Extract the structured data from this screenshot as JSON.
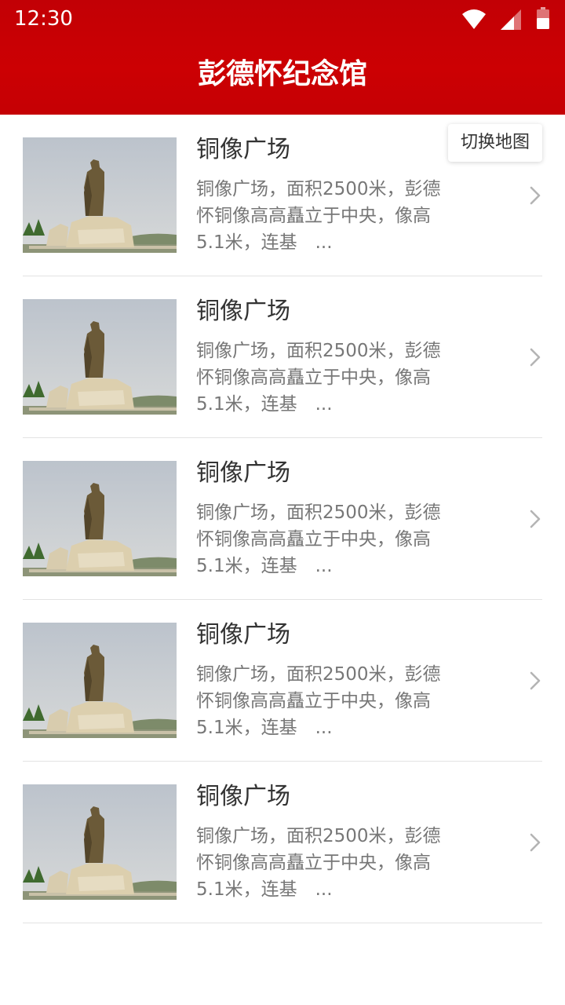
{
  "status_bar": {
    "time": "12:30",
    "icons": [
      "wifi-icon",
      "signal-icon",
      "battery-icon"
    ]
  },
  "header": {
    "title": "彭德怀纪念馆",
    "background_color": "#c8000a"
  },
  "map_toggle": {
    "label": "切换地图"
  },
  "list": {
    "items": [
      {
        "title": "铜像广场",
        "desc_lines": [
          "铜像广场，面积2500米，彭德",
          "怀铜像高高矗立于中央，像高",
          "5.1米，连基　..."
        ],
        "image": "statue-photo"
      },
      {
        "title": "铜像广场",
        "desc_lines": [
          "铜像广场，面积2500米，彭德",
          "怀铜像高高矗立于中央，像高",
          "5.1米，连基　..."
        ],
        "image": "statue-photo"
      },
      {
        "title": "铜像广场",
        "desc_lines": [
          "铜像广场，面积2500米，彭德",
          "怀铜像高高矗立于中央，像高",
          "5.1米，连基　..."
        ],
        "image": "statue-photo"
      },
      {
        "title": "铜像广场",
        "desc_lines": [
          "铜像广场，面积2500米，彭德",
          "怀铜像高高矗立于中央，像高",
          "5.1米，连基　..."
        ],
        "image": "statue-photo"
      },
      {
        "title": "铜像广场",
        "desc_lines": [
          "铜像广场，面积2500米，彭德",
          "怀铜像高高矗立于中央，像高",
          "5.1米，连基　..."
        ],
        "image": "statue-photo"
      }
    ]
  },
  "colors": {
    "accent": "#c8000a",
    "title_text": "#333333",
    "desc_text": "#777777",
    "divider": "#e3e3e3"
  }
}
